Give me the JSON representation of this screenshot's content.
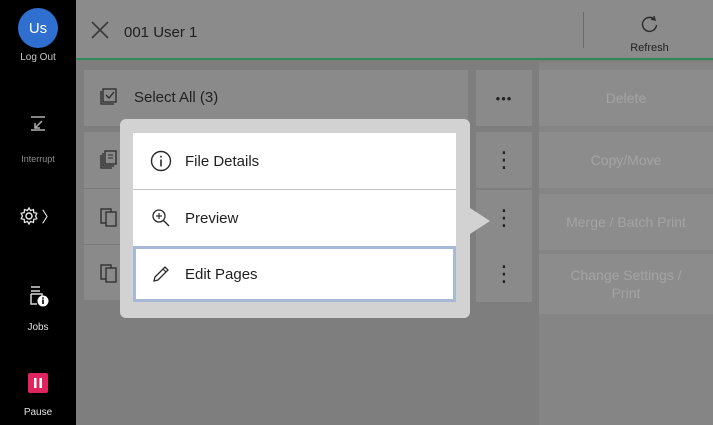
{
  "sidebar": {
    "avatar_initials": "Us",
    "logout_label": "Log Out",
    "interrupt_label": "Interrupt",
    "jobs_label": "Jobs",
    "pause_label": "Pause",
    "settings_chevron": "〉"
  },
  "header": {
    "title": "001 User 1",
    "refresh_label": "Refresh"
  },
  "list": {
    "select_all_label": "Select All (3)",
    "more_horizontal": "•••",
    "more_vertical": "⋮"
  },
  "actions": {
    "delete_label": "Delete",
    "copy_move_label": "Copy/Move",
    "merge_label": "Merge / Batch Print",
    "change_settings_label": "Change Settings / Print"
  },
  "popup_menu": {
    "items": [
      {
        "label": "File Details",
        "icon": "info-icon"
      },
      {
        "label": "Preview",
        "icon": "zoom-in-icon"
      },
      {
        "label": "Edit Pages",
        "icon": "pencil-icon",
        "selected": true
      }
    ]
  },
  "colors": {
    "avatar": "#2f6fd0",
    "pause": "#e0245e",
    "header_underline": "#2f8a57"
  }
}
